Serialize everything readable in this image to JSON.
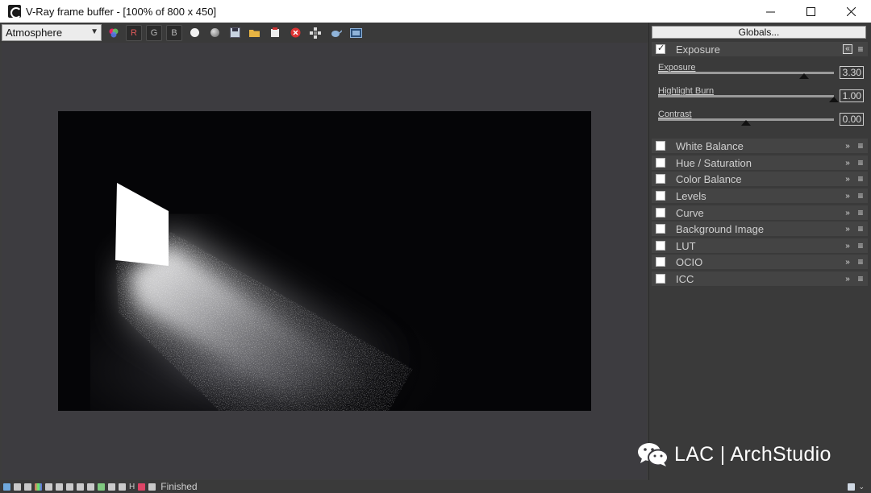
{
  "window": {
    "title": "V-Ray frame buffer - [100% of 800 x 450]",
    "minimize_icon": "minimize-icon",
    "maximize_icon": "maximize-icon",
    "close_icon": "close-icon"
  },
  "toolbar": {
    "channel": "Atmosphere",
    "r_label": "R",
    "g_label": "G",
    "b_label": "B"
  },
  "panel": {
    "globals_label": "Globals...",
    "exposure_section": {
      "label": "Exposure",
      "checked": true,
      "sliders": [
        {
          "label": "Exposure",
          "value": "3.30",
          "position": 0.83
        },
        {
          "label": "Highlight Burn",
          "value": "1.00",
          "position": 1.0
        },
        {
          "label": "Contrast",
          "value": "0.00",
          "position": 0.5
        }
      ]
    },
    "sections": [
      {
        "label": "White Balance",
        "checked": false
      },
      {
        "label": "Hue / Saturation",
        "checked": false
      },
      {
        "label": "Color Balance",
        "checked": false
      },
      {
        "label": "Levels",
        "checked": false
      },
      {
        "label": "Curve",
        "checked": false
      },
      {
        "label": "Background Image",
        "checked": false
      },
      {
        "label": "LUT",
        "checked": false
      },
      {
        "label": "OCIO",
        "checked": false
      },
      {
        "label": "ICC",
        "checked": false
      }
    ]
  },
  "statusbar": {
    "h_label": "H",
    "status": "Finished"
  },
  "watermark": {
    "text": "LAC | ArchStudio",
    "logo_icon": "wechat-icon"
  },
  "colors": {
    "viewport_bg": "#3d3c40",
    "render_bg": "#050507",
    "panel_row": "#444444"
  }
}
